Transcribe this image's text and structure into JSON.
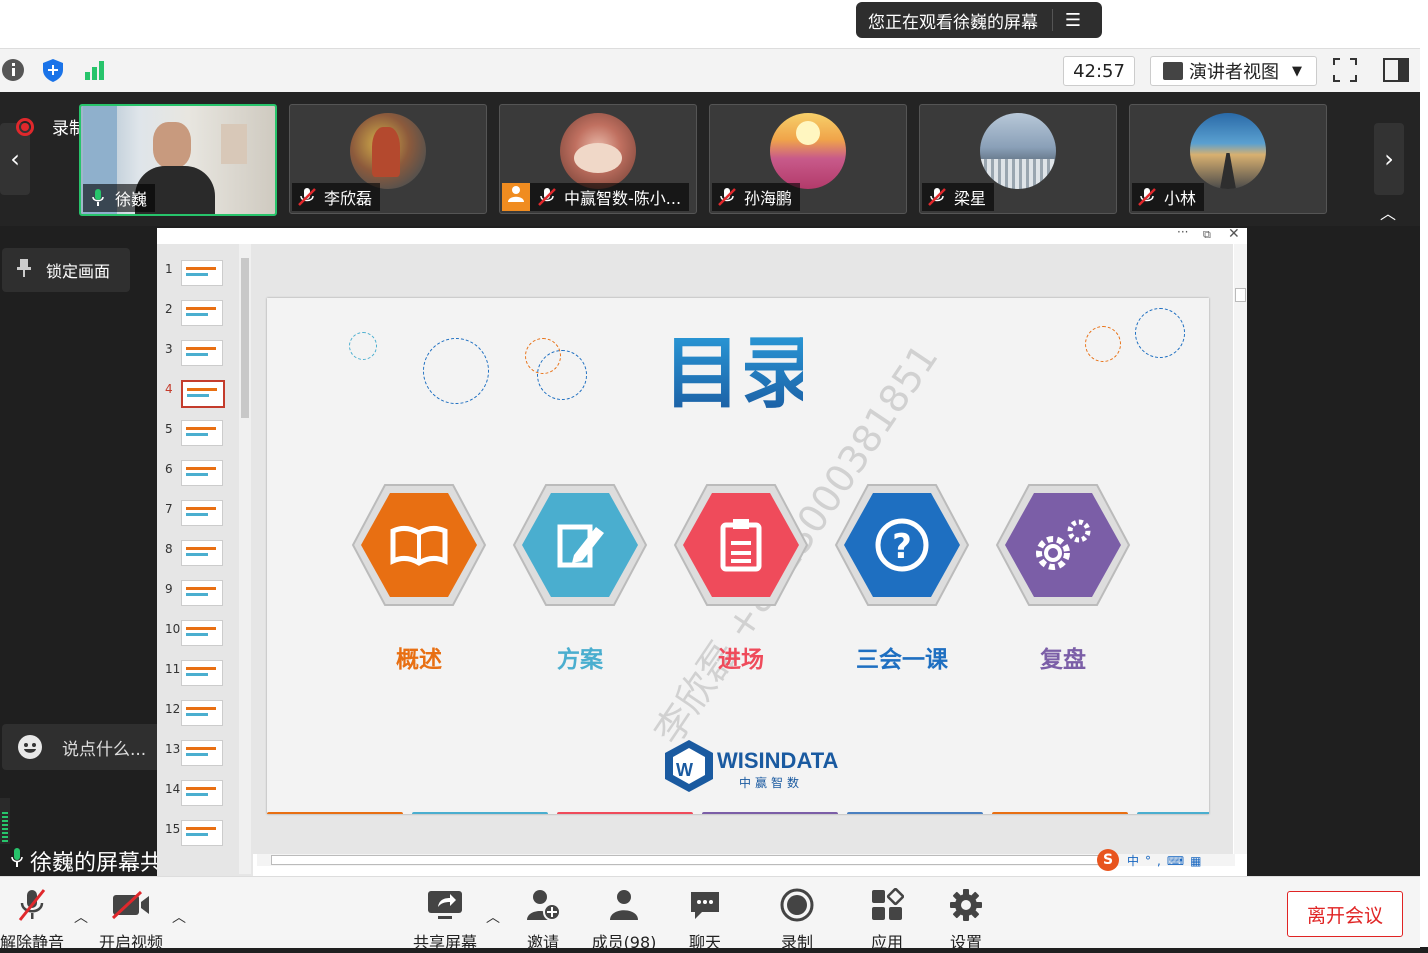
{
  "banner": {
    "viewing": "您正在观看徐巍的屏幕",
    "menu_icon": "list-icon"
  },
  "toolbar": {
    "timer": "42:57",
    "view_mode": "演讲者视图"
  },
  "participants": {
    "recording": "录制中",
    "tiles": [
      {
        "name": "徐巍",
        "mic": "on"
      },
      {
        "name": "李欣磊",
        "mic": "muted"
      },
      {
        "name": "中赢智数-陈小...",
        "mic": "muted"
      },
      {
        "name": "孙海鹏",
        "mic": "muted"
      },
      {
        "name": "梁星",
        "mic": "muted"
      },
      {
        "name": "小林",
        "mic": "muted"
      }
    ]
  },
  "side": {
    "lock_screen": "锁定画面",
    "chat_placeholder": "说点什么...",
    "share_label": "徐巍的屏幕共享"
  },
  "thumbnails": [
    "1",
    "2",
    "3",
    "4",
    "5",
    "6",
    "7",
    "8",
    "9",
    "10",
    "11",
    "12",
    "13",
    "14",
    "15"
  ],
  "slide": {
    "title": "目录",
    "items": [
      {
        "label": "概述",
        "color": "#e86f12",
        "icon": "book-icon"
      },
      {
        "label": "方案",
        "color": "#4aaecf",
        "icon": "edit-icon"
      },
      {
        "label": "进场",
        "color": "#ef4b5b",
        "icon": "clipboard-icon"
      },
      {
        "label": "三会一课",
        "color": "#1e6fc1",
        "icon": "question-icon"
      },
      {
        "label": "复盘",
        "color": "#7b5ea7",
        "icon": "gear-icon"
      }
    ],
    "brand_name": "WISINDATA",
    "brand_sub": "中赢智数",
    "watermark": "李欣磊 +8613000381851"
  },
  "controls": {
    "unmute": "解除静音",
    "start_video": "开启视频",
    "share_screen": "共享屏幕",
    "invite": "邀请",
    "members": "成员(98)",
    "chat": "聊天",
    "record": "录制",
    "apps": "应用",
    "settings": "设置",
    "leave": "离开会议"
  }
}
